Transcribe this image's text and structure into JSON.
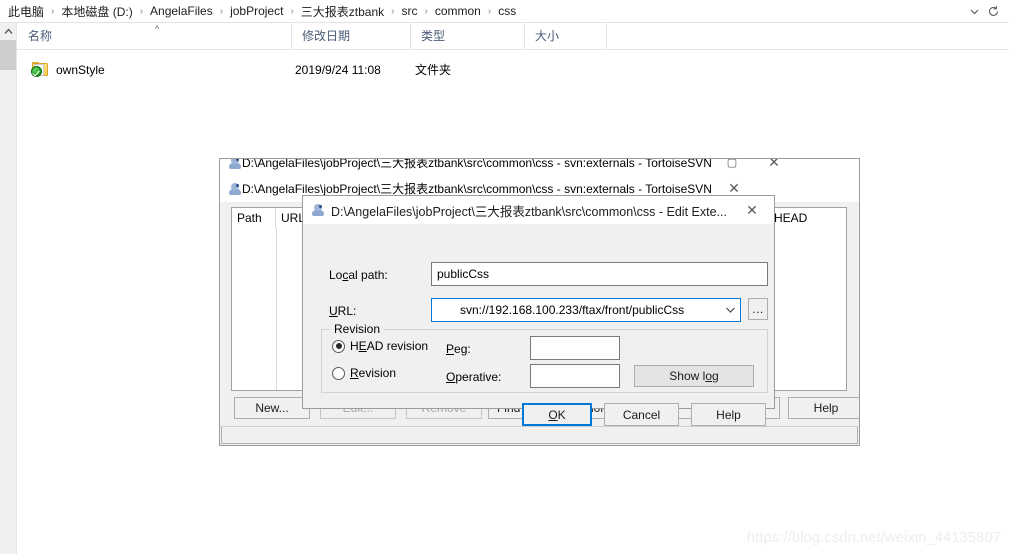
{
  "explorer": {
    "address": {
      "breadcrumbs": [
        "此电脑",
        "本地磁盘 (D:)",
        "AngelaFiles",
        "jobProject",
        "三大报表ztbank",
        "src",
        "common",
        "css"
      ],
      "separator": "›",
      "dropdown_icon": "chevron-down-icon",
      "refresh_icon": "refresh-icon"
    },
    "columns": [
      {
        "label": "名称",
        "sorted": "ascending",
        "sort_caret": "^"
      },
      {
        "label": "修改日期"
      },
      {
        "label": "类型"
      },
      {
        "label": "大小"
      }
    ],
    "rows": [
      {
        "name": "ownStyle",
        "date": "2019/9/24 11:08",
        "type": "文件夹",
        "size": "",
        "icon": "folder-svn-checked-icon"
      }
    ]
  },
  "externals_window": {
    "title": "D:\\AngelaFiles\\jobProject\\三大报表ztbank\\src\\common\\css - svn:externals - TortoiseSVN",
    "clipped_title": "D:\\AngelaFiles\\jobProject\\三大报表ztbank\\src\\common\\css - svn:externals - TortoiseSVN",
    "close_label": "✕",
    "maximize_label": "▢",
    "list": {
      "columns": [
        "Path",
        "URL",
        "HEAD"
      ],
      "rows": []
    },
    "buttons": [
      {
        "label": "New...",
        "enabled": true
      },
      {
        "label": "Edit...",
        "enabled": false
      },
      {
        "label": "Remove",
        "enabled": false
      },
      {
        "label": "Find HEAD-Revision",
        "enabled": true
      },
      {
        "label": "OK",
        "enabled": true
      },
      {
        "label": "Cancel",
        "enabled": true
      },
      {
        "label": "Help",
        "enabled": true
      }
    ]
  },
  "edit_dialog": {
    "title": "D:\\AngelaFiles\\jobProject\\三大报表ztbank\\src\\common\\css - Edit Exte...",
    "close_label": "✕",
    "local_path": {
      "label_pre": "Lo",
      "label_accel": "c",
      "label_post": "al path:",
      "value": "publicCss"
    },
    "url": {
      "label_accel": "U",
      "label_post": "RL:",
      "value": "svn://192.168.100.233/ftax/front/publicCss",
      "dropdown_icon": "chevron-down-icon",
      "browse_label": "..."
    },
    "revision_group": {
      "title": "Revision",
      "head_radio": {
        "label_pre": "H",
        "label_accel": "E",
        "label_post": "AD revision",
        "checked": true
      },
      "rev_radio": {
        "label_pre": "",
        "label_accel": "R",
        "label_post": "evision",
        "checked": false
      },
      "peg": {
        "label_accel": "P",
        "label_post": "eg:",
        "value": ""
      },
      "operative": {
        "label_accel": "O",
        "label_post": "perative:",
        "value": ""
      },
      "show_log_label_pre": "Show l",
      "show_log_accel": "o",
      "show_log_post": "g"
    },
    "buttons": [
      {
        "label": "OK",
        "default": true,
        "accel": "O"
      },
      {
        "label": "Cancel",
        "default": false
      },
      {
        "label": "Help",
        "default": false
      }
    ]
  },
  "watermark": "https://blog.csdn.net/weixin_44135807",
  "colors": {
    "accent": "#0078d7",
    "window_bg": "#f0f0f0",
    "header_text": "#4a5b78"
  }
}
